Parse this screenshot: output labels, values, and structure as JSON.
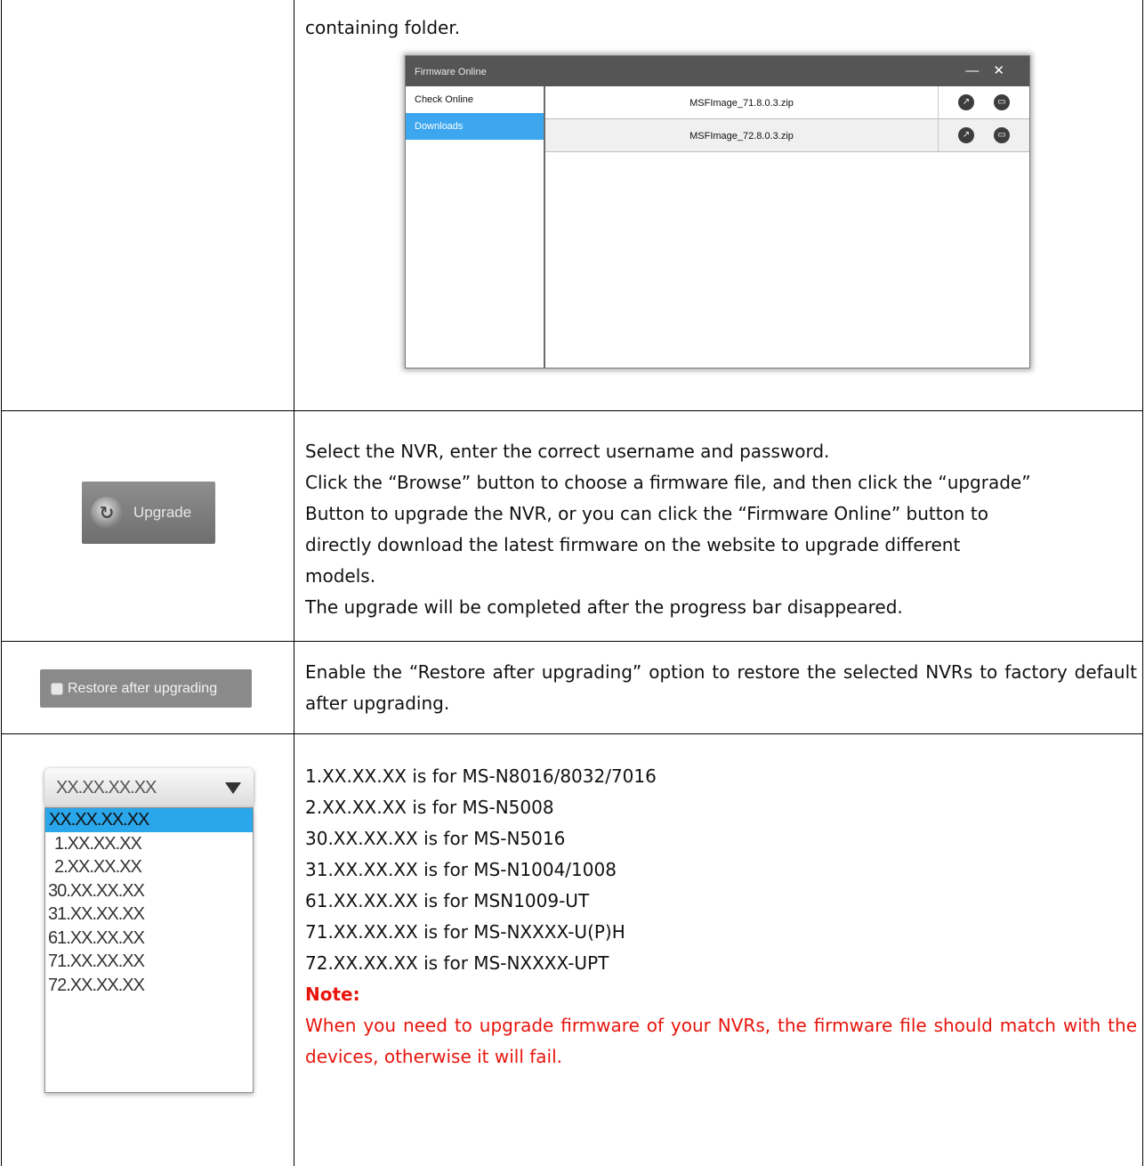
{
  "row1": {
    "text": "containing folder.",
    "firmware_window": {
      "title": "Firmware Online",
      "minimize_glyph": "—",
      "close_glyph": "✕",
      "nav": [
        {
          "label": "Check Online",
          "active": false
        },
        {
          "label": "Downloads",
          "active": true
        }
      ],
      "files": [
        {
          "name": "MSFImage_71.8.0.3.zip"
        },
        {
          "name": "MSFImage_72.8.0.3.zip"
        }
      ]
    }
  },
  "row2": {
    "button_label": "Upgrade",
    "lines": [
      "Select the NVR, enter the correct username and password.",
      "Click the “Browse” button to choose a firmware file, and then click the “upgrade”",
      "Button to upgrade the NVR, or you can click the “Firmware Online” button to",
      "directly download the latest firmware on the website to upgrade different",
      "models.",
      "The upgrade will be completed after the progress bar disappeared."
    ]
  },
  "row3": {
    "checkbox_label": "Restore after upgrading",
    "text": "Enable the “Restore after upgrading” option to restore the selected NVRs to factory default after upgrading."
  },
  "row4": {
    "dropdown": {
      "selected": "XX.XX.XX.XX",
      "options": [
        "XX.XX.XX.XX",
        "1.XX.XX.XX",
        "2.XX.XX.XX",
        "30.XX.XX.XX",
        "31.XX.XX.XX",
        "61.XX.XX.XX",
        "71.XX.XX.XX",
        "72.XX.XX.XX"
      ]
    },
    "lines": [
      "1.XX.XX.XX is for MS-N8016/8032/7016",
      "2.XX.XX.XX is for MS-N5008",
      "30.XX.XX.XX is for MS-N5016",
      "31.XX.XX.XX is for MS-N1004/1008",
      "61.XX.XX.XX is for MSN1009-UT",
      "71.XX.XX.XX is for MS-NXXXX-U(P)H",
      "72.XX.XX.XX is for MS-NXXXX-UPT"
    ],
    "note_label": "Note:",
    "note_text": "When you need to upgrade firmware of your NVRs, the firmware file should match with the devices, otherwise it will fail."
  }
}
